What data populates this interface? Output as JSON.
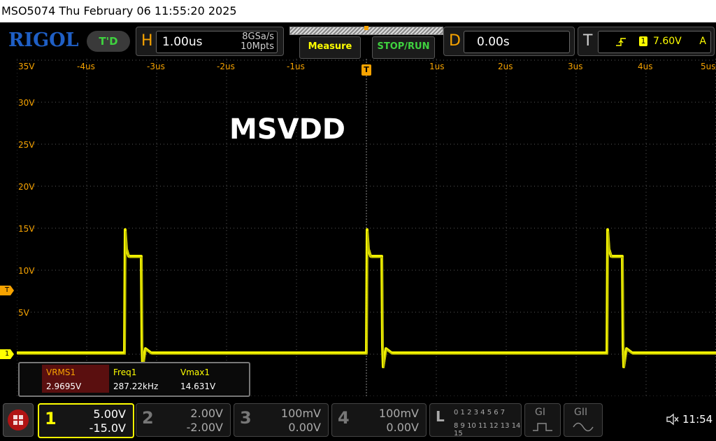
{
  "status_bar": {
    "title": "MSO5074  Thu February 06 11:55:20 2025",
    "clock": "11:54"
  },
  "header": {
    "logo": "RIGOL",
    "td_badge": "T'D",
    "horizontal": {
      "letter": "H",
      "timebase": "1.00us",
      "sample_rate": "8GSa/s",
      "memory_depth": "10Mpts"
    },
    "measure_label": "Measure",
    "stop_run_label": "STOP/RUN",
    "delay": {
      "letter": "D",
      "value": "0.00s"
    },
    "trigger": {
      "letter": "T",
      "level": "7.60V",
      "source": "1",
      "mode": "A"
    }
  },
  "screen": {
    "annotation": "MSVDD",
    "y_labels": [
      "35V",
      "30V",
      "25V",
      "20V",
      "15V",
      "10V",
      "5V"
    ],
    "x_labels": [
      "-4us",
      "-3us",
      "-2us",
      "-1us",
      "1us",
      "2us",
      "3us",
      "4us",
      "5us"
    ],
    "trigger_marker": "T",
    "channel1_marker": "1"
  },
  "measurements": {
    "headers": [
      "VRMS1",
      "Freq1",
      "Vmax1"
    ],
    "values": [
      "2.9695V",
      "287.22kHz",
      "14.631V"
    ]
  },
  "channels": [
    {
      "num": "1",
      "scale": "5.00V",
      "offset": "-15.0V",
      "color": "#ffff00",
      "active": true
    },
    {
      "num": "2",
      "scale": "2.00V",
      "offset": "-2.00V",
      "color": "#777777",
      "active": false
    },
    {
      "num": "3",
      "scale": "100mV",
      "offset": "0.00V",
      "color": "#777777",
      "active": false
    },
    {
      "num": "4",
      "scale": "100mV",
      "offset": "0.00V",
      "color": "#777777",
      "active": false
    }
  ],
  "logic": {
    "letter": "L",
    "row1": "0 1 2 3  4 5 6 7",
    "row2": "8 9 10 11 12 13 14 15"
  },
  "decode": {
    "g1": "GI",
    "g2": "GII"
  },
  "colors": {
    "ch1": "#ffff00",
    "trigger": "#f7a300",
    "brand": "#1f5fc5",
    "grid": "#5a5a5a"
  }
}
